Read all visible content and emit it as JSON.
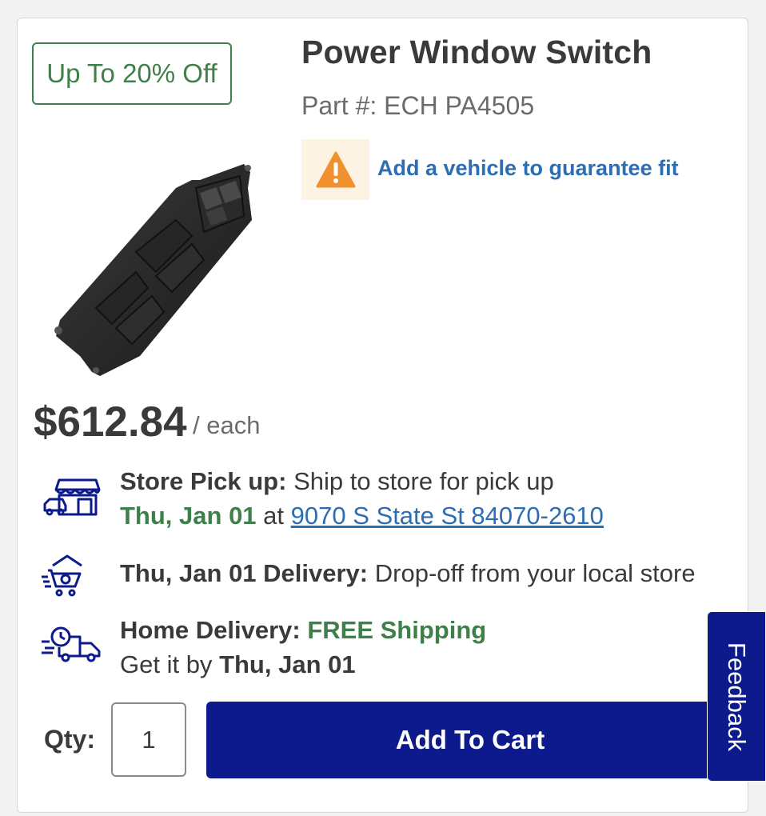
{
  "product": {
    "badge": "Up To 20% Off",
    "title": "Power Window Switch",
    "part_number": "Part #: ECH PA4505",
    "fit_link": "Add a vehicle to guarantee fit",
    "price": "$612.84",
    "price_unit": "/ each"
  },
  "fulfillment": {
    "pickup": {
      "label": "Store Pick up:",
      "text": "Ship to store for pick up",
      "date": "Thu, Jan 01",
      "at": "at",
      "address": "9070 S State St 84070-2610"
    },
    "delivery": {
      "label": "Thu, Jan 01 Delivery:",
      "text": "Drop-off from your local store"
    },
    "home": {
      "label": "Home Delivery:",
      "shipping": "FREE Shipping",
      "get_it_by": "Get it by",
      "date": "Thu, Jan 01"
    }
  },
  "cart": {
    "qty_label": "Qty:",
    "qty_value": "1",
    "add_button": "Add To Cart"
  },
  "feedback_tab": "Feedback",
  "icons": {
    "warning": "warning-triangle-icon",
    "store": "store-pickup-icon",
    "delivery": "cart-house-delivery-icon",
    "truck": "fast-truck-icon"
  },
  "colors": {
    "green": "#3f7f4a",
    "link_blue": "#2c6db3",
    "button_navy": "#0c1a8c",
    "warning_orange": "#f0902e"
  }
}
